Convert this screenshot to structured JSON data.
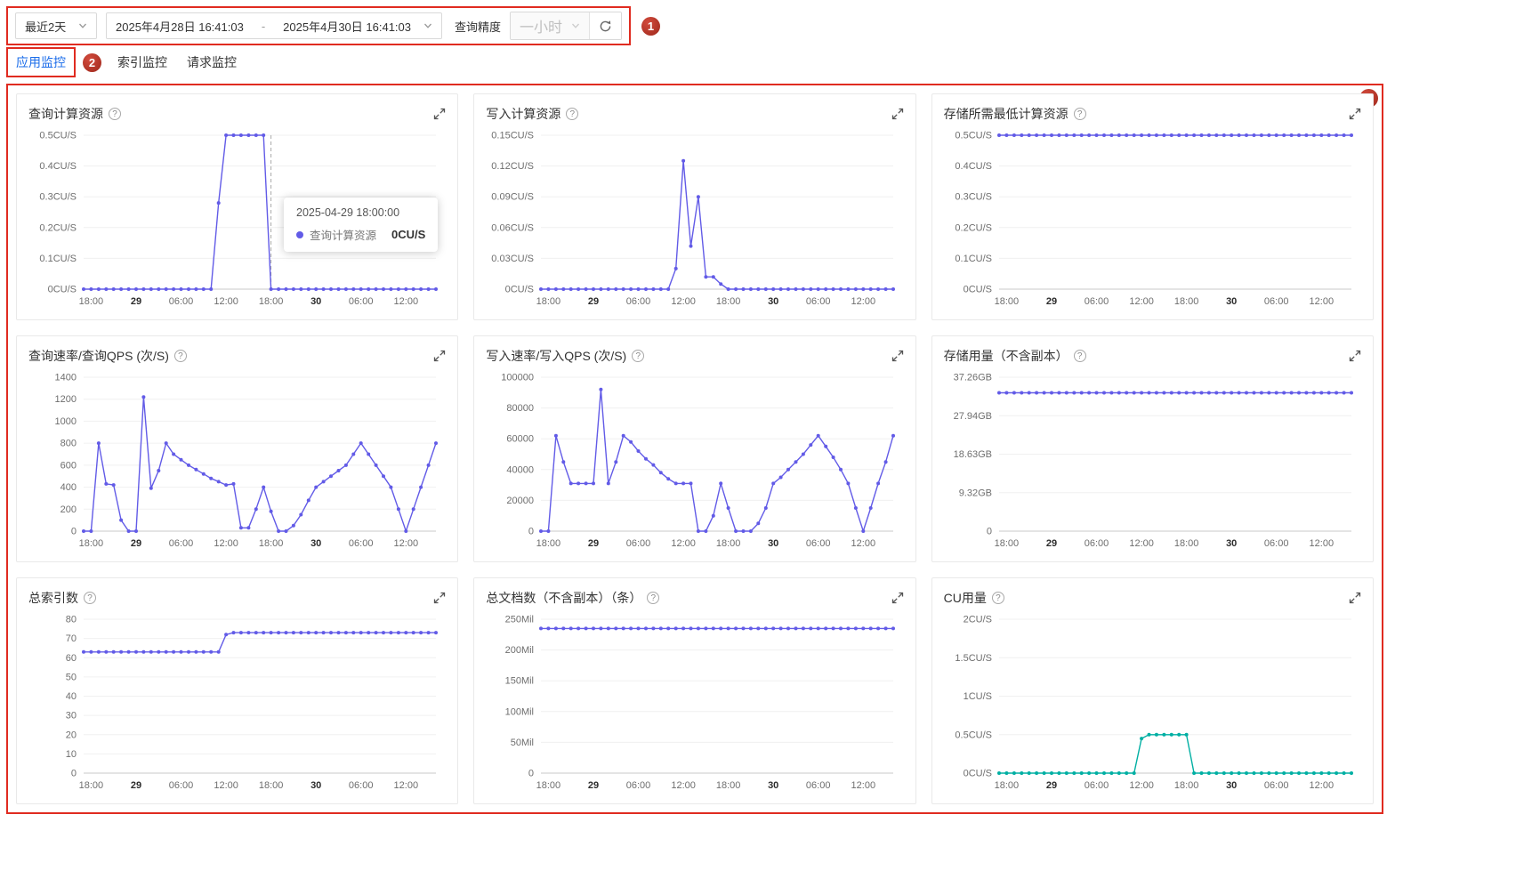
{
  "toolbar": {
    "range_value": "最近2天",
    "date_start": "2025年4月28日 16:41:03",
    "date_separator": "-",
    "date_end": "2025年4月30日 16:41:03",
    "precision_label": "查询精度",
    "precision_value": "一小时"
  },
  "tabs": [
    {
      "label": "应用监控",
      "active": true
    },
    {
      "label": "索引监控",
      "active": false
    },
    {
      "label": "请求监控",
      "active": false
    }
  ],
  "annotations": {
    "badge1": "1",
    "badge2": "2",
    "badge3": "3"
  },
  "tooltip": {
    "time": "2025-04-29 18:00:00",
    "series": "查询计算资源",
    "value": "0CU/S"
  },
  "icons": {
    "help_glyph": "?"
  },
  "colors": {
    "accent_purple": "#625BE7",
    "accent_teal": "#00AFA3",
    "tab_active": "#1A6CEA",
    "annotation_red": "#E02B20"
  },
  "chart_x_axis": {
    "tick_indices": [
      1,
      7,
      13,
      19,
      25,
      31,
      37,
      43
    ],
    "tick_labels": [
      "18:00",
      "29",
      "06:00",
      "12:00",
      "18:00",
      "30",
      "06:00",
      "12:00"
    ],
    "bold_labels": [
      "29",
      "30"
    ]
  },
  "chart_data": [
    {
      "type": "line",
      "title": "查询计算资源",
      "color": "#625BE7",
      "y_ticks": [
        "0.5CU/S",
        "0.4CU/S",
        "0.3CU/S",
        "0.2CU/S",
        "0.1CU/S",
        "0CU/S"
      ],
      "y_max": 0.5,
      "marker_index": 25,
      "values": [
        0,
        0,
        0,
        0,
        0,
        0,
        0,
        0,
        0,
        0,
        0,
        0,
        0,
        0,
        0,
        0,
        0,
        0,
        0.28,
        0.5,
        0.5,
        0.5,
        0.5,
        0.5,
        0.5,
        0,
        0,
        0,
        0,
        0,
        0,
        0,
        0,
        0,
        0,
        0,
        0,
        0,
        0,
        0,
        0,
        0,
        0,
        0,
        0,
        0,
        0,
        0
      ]
    },
    {
      "type": "line",
      "title": "写入计算资源",
      "color": "#625BE7",
      "y_ticks": [
        "0.15CU/S",
        "0.12CU/S",
        "0.09CU/S",
        "0.06CU/S",
        "0.03CU/S",
        "0CU/S"
      ],
      "y_max": 0.15,
      "values": [
        0,
        0,
        0,
        0,
        0,
        0,
        0,
        0,
        0,
        0,
        0,
        0,
        0,
        0,
        0,
        0,
        0,
        0,
        0.02,
        0.125,
        0.042,
        0.09,
        0.012,
        0.012,
        0.005,
        0,
        0,
        0,
        0,
        0,
        0,
        0,
        0,
        0,
        0,
        0,
        0,
        0,
        0,
        0,
        0,
        0,
        0,
        0,
        0,
        0,
        0,
        0
      ]
    },
    {
      "type": "line",
      "title": "存储所需最低计算资源",
      "color": "#625BE7",
      "y_ticks": [
        "0.5CU/S",
        "0.4CU/S",
        "0.3CU/S",
        "0.2CU/S",
        "0.1CU/S",
        "0CU/S"
      ],
      "y_max": 0.5,
      "values": [
        0.5,
        0.5,
        0.5,
        0.5,
        0.5,
        0.5,
        0.5,
        0.5,
        0.5,
        0.5,
        0.5,
        0.5,
        0.5,
        0.5,
        0.5,
        0.5,
        0.5,
        0.5,
        0.5,
        0.5,
        0.5,
        0.5,
        0.5,
        0.5,
        0.5,
        0.5,
        0.5,
        0.5,
        0.5,
        0.5,
        0.5,
        0.5,
        0.5,
        0.5,
        0.5,
        0.5,
        0.5,
        0.5,
        0.5,
        0.5,
        0.5,
        0.5,
        0.5,
        0.5,
        0.5,
        0.5,
        0.5,
        0.5
      ]
    },
    {
      "type": "line",
      "title": "查询速率/查询QPS (次/S)",
      "color": "#625BE7",
      "y_ticks": [
        "1400",
        "1200",
        "1000",
        "800",
        "600",
        "400",
        "200",
        "0"
      ],
      "y_max": 1400,
      "values": [
        0,
        0,
        800,
        430,
        420,
        100,
        0,
        0,
        1220,
        390,
        550,
        800,
        700,
        650,
        600,
        560,
        520,
        480,
        450,
        420,
        430,
        30,
        30,
        200,
        400,
        180,
        0,
        0,
        50,
        150,
        280,
        400,
        450,
        500,
        550,
        600,
        700,
        800,
        700,
        600,
        500,
        400,
        200,
        0,
        200,
        400,
        600,
        800
      ]
    },
    {
      "type": "line",
      "title": "写入速率/写入QPS (次/S)",
      "color": "#625BE7",
      "y_ticks": [
        "100000",
        "80000",
        "60000",
        "40000",
        "20000",
        "0"
      ],
      "y_max": 100000,
      "values": [
        0,
        0,
        62000,
        45000,
        31000,
        31000,
        31000,
        31000,
        92000,
        31000,
        45000,
        62000,
        58000,
        52000,
        47000,
        43000,
        38000,
        34000,
        31000,
        31000,
        31000,
        0,
        0,
        10000,
        31000,
        15000,
        0,
        0,
        0,
        5000,
        15000,
        31000,
        35000,
        40000,
        45000,
        50000,
        56000,
        62000,
        55000,
        48000,
        40000,
        31000,
        15000,
        0,
        15000,
        31000,
        45000,
        62000
      ]
    },
    {
      "type": "line",
      "title": "存储用量（不含副本）",
      "color": "#625BE7",
      "y_ticks": [
        "37.26GB",
        "27.94GB",
        "18.63GB",
        "9.32GB",
        "0"
      ],
      "y_max": 37.26,
      "values": [
        33.5,
        33.5,
        33.5,
        33.5,
        33.5,
        33.5,
        33.5,
        33.5,
        33.5,
        33.5,
        33.5,
        33.5,
        33.5,
        33.5,
        33.5,
        33.5,
        33.5,
        33.5,
        33.5,
        33.5,
        33.5,
        33.5,
        33.5,
        33.5,
        33.5,
        33.5,
        33.5,
        33.5,
        33.5,
        33.5,
        33.5,
        33.5,
        33.5,
        33.5,
        33.5,
        33.5,
        33.5,
        33.5,
        33.5,
        33.5,
        33.5,
        33.5,
        33.5,
        33.5,
        33.5,
        33.5,
        33.5,
        33.5
      ]
    },
    {
      "type": "line",
      "title": "总索引数",
      "color": "#625BE7",
      "y_ticks": [
        "80",
        "70",
        "60",
        "50",
        "40",
        "30",
        "20",
        "10",
        "0"
      ],
      "y_max": 80,
      "values": [
        63,
        63,
        63,
        63,
        63,
        63,
        63,
        63,
        63,
        63,
        63,
        63,
        63,
        63,
        63,
        63,
        63,
        63,
        63,
        72,
        73,
        73,
        73,
        73,
        73,
        73,
        73,
        73,
        73,
        73,
        73,
        73,
        73,
        73,
        73,
        73,
        73,
        73,
        73,
        73,
        73,
        73,
        73,
        73,
        73,
        73,
        73,
        73
      ]
    },
    {
      "type": "line",
      "title": "总文档数（不含副本）（条）",
      "color": "#625BE7",
      "y_ticks": [
        "250Mil",
        "200Mil",
        "150Mil",
        "100Mil",
        "50Mil",
        "0"
      ],
      "y_max": 250,
      "values": [
        235,
        235,
        235,
        235,
        235,
        235,
        235,
        235,
        235,
        235,
        235,
        235,
        235,
        235,
        235,
        235,
        235,
        235,
        235,
        235,
        235,
        235,
        235,
        235,
        235,
        235,
        235,
        235,
        235,
        235,
        235,
        235,
        235,
        235,
        235,
        235,
        235,
        235,
        235,
        235,
        235,
        235,
        235,
        235,
        235,
        235,
        235,
        235
      ]
    },
    {
      "type": "line",
      "title": "CU用量",
      "color": "#00AFA3",
      "y_ticks": [
        "2CU/S",
        "1.5CU/S",
        "1CU/S",
        "0.5CU/S",
        "0CU/S"
      ],
      "y_max": 2,
      "values": [
        0,
        0,
        0,
        0,
        0,
        0,
        0,
        0,
        0,
        0,
        0,
        0,
        0,
        0,
        0,
        0,
        0,
        0,
        0,
        0.45,
        0.5,
        0.5,
        0.5,
        0.5,
        0.5,
        0.5,
        0,
        0,
        0,
        0,
        0,
        0,
        0,
        0,
        0,
        0,
        0,
        0,
        0,
        0,
        0,
        0,
        0,
        0,
        0,
        0,
        0,
        0
      ]
    }
  ]
}
